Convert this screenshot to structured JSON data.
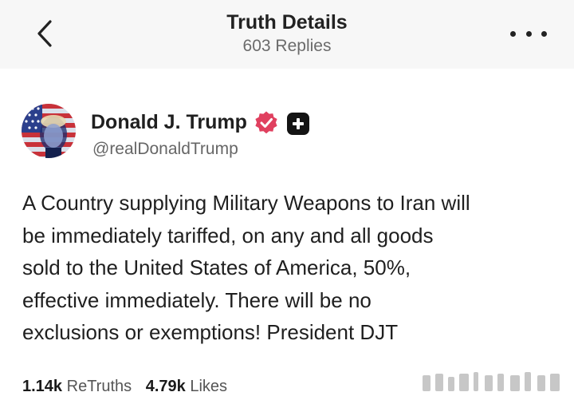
{
  "header": {
    "title": "Truth Details",
    "replies": "603 Replies",
    "back_icon": "chevron-left-icon",
    "more_icon": "more-horizontal-icon"
  },
  "author": {
    "name": "Donald J. Trump",
    "handle": "@realDonaldTrump",
    "verified_icon": "verified-badge-icon",
    "plus_icon": "plus-badge-icon",
    "verified_color": "#e0405f"
  },
  "post": {
    "lines": [
      "A Country supplying Military Weapons to Iran will",
      "be immediately tariffed, on any and all goods",
      "sold to the United States of America, 50%,",
      "effective immediately. There will be no",
      "exclusions or exemptions! President DJT"
    ]
  },
  "stats": {
    "retruths_count": "1.14k",
    "retruths_label": "ReTruths",
    "likes_count": "4.79k",
    "likes_label": "Likes"
  }
}
